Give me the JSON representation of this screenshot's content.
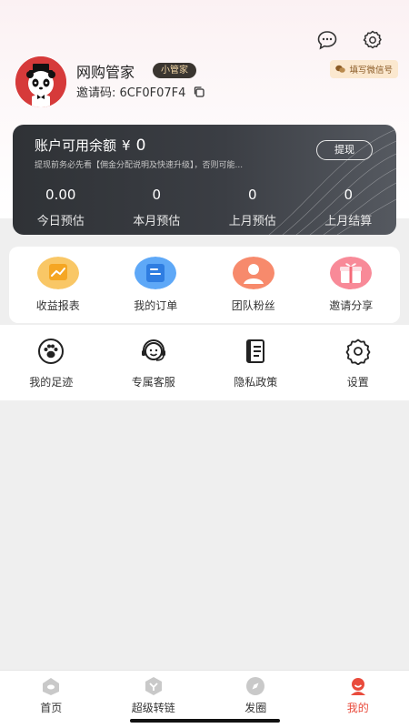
{
  "header": {
    "name": "网购管家",
    "badge": "小管家",
    "invite_label": "邀请码: 6CF0F07F4",
    "wechat_button": "填写微信号"
  },
  "balance": {
    "title": "账户可用余额",
    "currency": "¥",
    "amount": "0",
    "note": "提现前务必先看【佣金分配说明及快速升级】，否则可能...",
    "withdraw_label": "提现",
    "stats": [
      {
        "value": "0.00",
        "label": "今日预估"
      },
      {
        "value": "0",
        "label": "本月预估"
      },
      {
        "value": "0",
        "label": "上月预估"
      },
      {
        "value": "0",
        "label": "上月结算"
      }
    ]
  },
  "quick_actions": [
    {
      "label": "收益报表",
      "icon": "revenue-report-icon",
      "color": "#f5b23d"
    },
    {
      "label": "我的订单",
      "icon": "order-icon",
      "color": "#3d8ef0"
    },
    {
      "label": "团队粉丝",
      "icon": "team-icon",
      "color": "#f06a4a"
    },
    {
      "label": "邀请分享",
      "icon": "gift-icon",
      "color": "#f46a78"
    }
  ],
  "tools": [
    {
      "label": "我的足迹",
      "icon": "footprint-icon"
    },
    {
      "label": "专属客服",
      "icon": "customer-service-icon"
    },
    {
      "label": "隐私政策",
      "icon": "privacy-policy-icon"
    },
    {
      "label": "设置",
      "icon": "settings-gear-icon"
    }
  ],
  "tabbar": [
    {
      "label": "首页",
      "icon": "home-tab-icon",
      "active": false
    },
    {
      "label": "超级转链",
      "icon": "super-link-tab-icon",
      "active": false
    },
    {
      "label": "发圈",
      "icon": "moments-tab-icon",
      "active": false
    },
    {
      "label": "我的",
      "icon": "profile-tab-icon",
      "active": true
    }
  ],
  "colors": {
    "accent": "#e94b3c",
    "card_dark": "#34373c",
    "badge_bg": "#3a3530",
    "badge_text": "#f4d8a8",
    "wechat_bg": "#fbe8cf"
  }
}
